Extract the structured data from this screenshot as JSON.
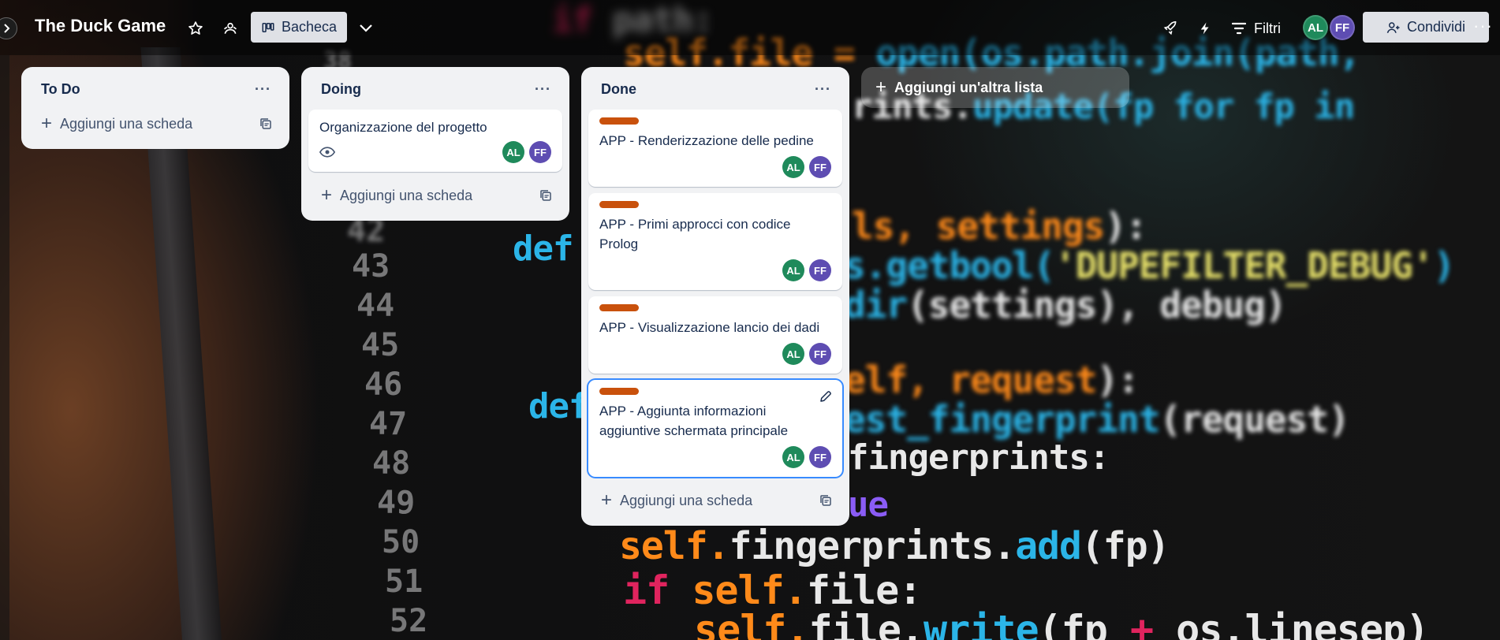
{
  "header": {
    "board_title": "The Duck Game",
    "view_label": "Bacheca",
    "filter_label": "Filtri",
    "share_label": "Condividi",
    "members": [
      "AL",
      "FF"
    ]
  },
  "lists": [
    {
      "title": "To Do",
      "add_card_label": "Aggiungi una scheda",
      "cards": []
    },
    {
      "title": "Doing",
      "add_card_label": "Aggiungi una scheda",
      "cards": [
        {
          "title": "Organizzazione del progetto",
          "members": [
            "AL",
            "FF"
          ],
          "watching": true
        }
      ]
    },
    {
      "title": "Done",
      "add_card_label": "Aggiungi una scheda",
      "cards": [
        {
          "title": "APP - Renderizzazione delle pedine",
          "label_color": "#c9510c",
          "members": [
            "AL",
            "FF"
          ]
        },
        {
          "title": "APP - Primi approcci con codice Prolog",
          "label_color": "#c9510c",
          "members": [
            "AL",
            "FF"
          ]
        },
        {
          "title": "APP - Visualizzazione lancio dei dadi",
          "label_color": "#c9510c",
          "members": [
            "AL",
            "FF"
          ]
        },
        {
          "title": "APP - Aggiunta informazioni aggiuntive schermata principale",
          "label_color": "#c9510c",
          "members": [
            "AL",
            "FF"
          ],
          "selected": true
        }
      ]
    }
  ],
  "add_list_label": "Aggiungi un'altra lista",
  "colors": {
    "label": "#c9510c",
    "avatar_al": "#1f8a5b",
    "avatar_ff": "#5e4db2",
    "selection": "#388bff"
  }
}
